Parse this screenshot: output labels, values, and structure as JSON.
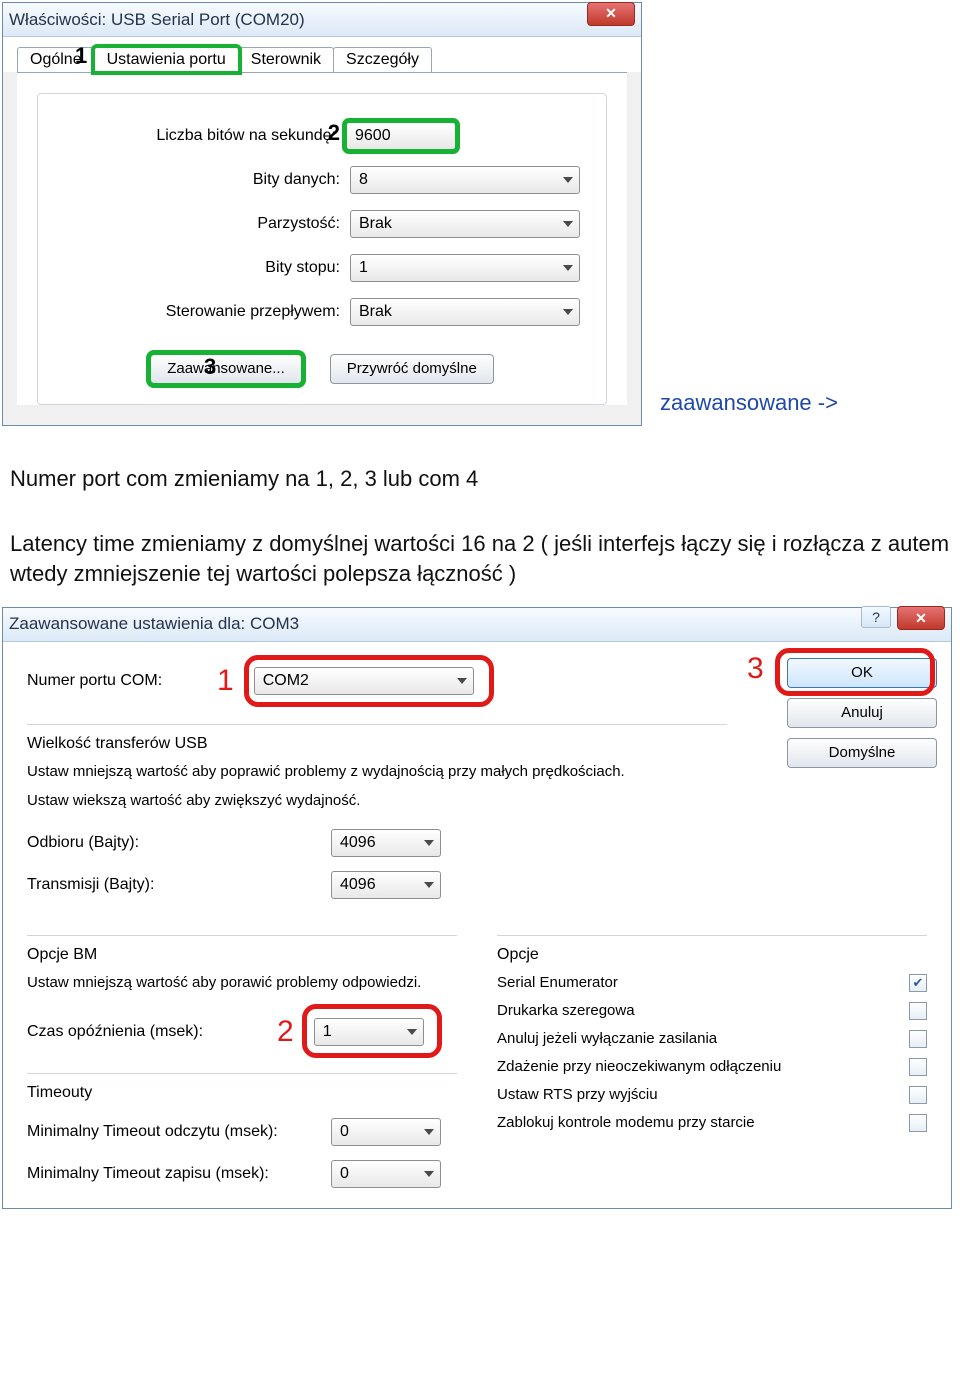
{
  "dialog1": {
    "title": "Właściwości: USB Serial Port (COM20)",
    "tabs": {
      "t1": "Ogólne",
      "t2": "Ustawienia portu",
      "t3": "Sterownik",
      "t4": "Szczegóły"
    },
    "labels": {
      "bps": "Liczba bitów na sekundę:",
      "databits": "Bity danych:",
      "parity": "Parzystość:",
      "stopbits": "Bity stopu:",
      "flow": "Sterowanie przepływem:"
    },
    "values": {
      "bps": "9600",
      "databits": "8",
      "parity": "Brak",
      "stopbits": "1",
      "flow": "Brak"
    },
    "buttons": {
      "advanced": "Zaawansowane...",
      "restore": "Przywróć domyślne"
    },
    "annotations": {
      "a1": "1",
      "a2": "2",
      "a3": "3"
    }
  },
  "article": {
    "line_after1": "zaawansowane ->",
    "line2": "Numer port com zmieniamy na 1, 2, 3 lub com 4",
    "line3a": "Latency time zmieniamy z domyślnej wartości 16 na 2 ( jeśli interfejs łączy się i rozłącza z autem wtedy zmniejszenie tej wartości polepsza łączność )"
  },
  "dialog2": {
    "title": "Zaawansowane ustawienia dla: COM3",
    "labels": {
      "port": "Numer portu COM:",
      "usb_heading": "Wielkość transferów USB",
      "hint1": "Ustaw mniejszą wartość aby poprawić problemy z wydajnością przy małych prędkościach.",
      "hint2": "Ustaw wiekszą wartość aby zwiększyć wydajność.",
      "recv": "Odbioru (Bajty):",
      "send": "Transmisji (Bajty):",
      "bm_heading": "Opcje BM",
      "bm_hint": "Ustaw mniejszą wartość aby porawić problemy odpowiedzi.",
      "latency": "Czas opóźnienia (msek):",
      "timeouts": "Timeouty",
      "t_read": "Minimalny Timeout odczytu (msek):",
      "t_write": "Minimalny Timeout zapisu (msek):",
      "opts_heading": "Opcje",
      "opt_enum": "Serial Enumerator",
      "opt_printer": "Drukarka szeregowa",
      "opt_cancel": "Anuluj jeżeli wyłączanie zasilania",
      "opt_surprise": "Zdażenie przy nieoczekiwanym odłączeniu",
      "opt_rts": "Ustaw RTS przy wyjściu",
      "opt_modem": "Zablokuj kontrole modemu przy starcie"
    },
    "values": {
      "port": "COM2",
      "recv": "4096",
      "send": "4096",
      "latency": "1",
      "t_read": "0",
      "t_write": "0"
    },
    "buttons": {
      "ok": "OK",
      "cancel": "Anuluj",
      "defaults": "Domyślne"
    },
    "annotations": {
      "a1": "1",
      "a2": "2",
      "a3": "3"
    }
  }
}
